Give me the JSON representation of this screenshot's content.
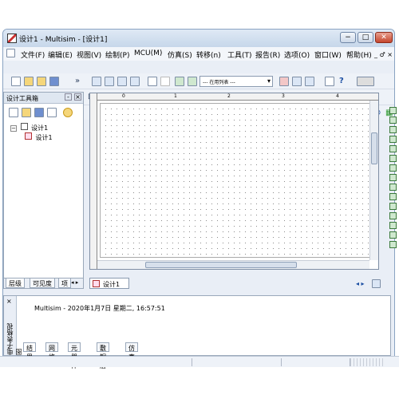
{
  "window": {
    "title": "设计1 - Multisim - [设计1]",
    "controls": {
      "minimize": "−",
      "maximize": "□",
      "close": "✕"
    }
  },
  "menu": {
    "items": [
      "文件(F)",
      "编辑(E)",
      "视图(V)",
      "绘制(P)",
      "MCU(M)",
      "仿真(S)",
      "转移(n)",
      "工具(T)",
      "报告(R)",
      "选项(O)",
      "窗口(W)",
      "帮助(H)"
    ],
    "mdi_controls": "_ ♂ ×"
  },
  "toolbar": {
    "in_use_list_placeholder": "--- 在用列表 ---",
    "more_glyph": "»",
    "help_glyph": "?"
  },
  "simulation": {
    "run_glyph": "▶",
    "pause_glyph": "II",
    "stop_glyph": "■"
  },
  "toolbox": {
    "title": "设计工具箱",
    "close_glyph": "×",
    "pin_glyph": "-",
    "tree_root": "设计1",
    "tree_child": "设计1",
    "tabs": [
      "层级",
      "可见度",
      "项"
    ]
  },
  "workspace": {
    "tab_label": "设计1",
    "ruler_marks": [
      "0",
      "1",
      "2",
      "3",
      "4"
    ]
  },
  "spreadsheet": {
    "side_label": "电子表格视图",
    "log_entry": "Multisim  -  2020年1月7日 星期二, 16:57:51",
    "tabs": [
      "结果",
      "网络",
      "元器件",
      "敷铜层",
      "仿真"
    ]
  },
  "colors": {
    "titlebar": "#c6d7ea",
    "workspace_bg": "#ffffff",
    "run_green": "#2f9a2f",
    "accent_blue": "#1c4fa3"
  }
}
